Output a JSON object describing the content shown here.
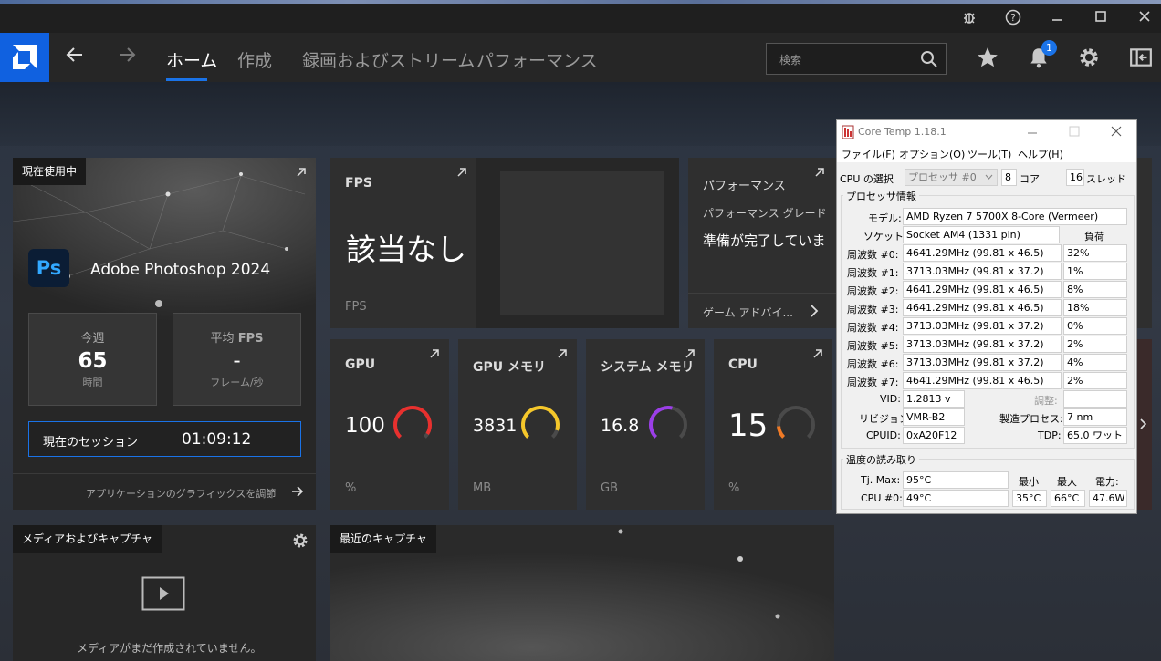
{
  "titlebar": {
    "icons": [
      "bug-icon",
      "help-icon",
      "minimize-icon",
      "maximize-icon",
      "close-icon"
    ]
  },
  "nav": {
    "tabs": [
      "ホーム",
      "作成",
      "録画およびストリーム",
      "パフォーマンス"
    ],
    "active_tab": "ホーム",
    "search_placeholder": "検索",
    "notification_count": "1"
  },
  "current_app": {
    "tag": "現在使用中",
    "app_icon_text": "Ps",
    "app_name": "Adobe Photoshop 2024",
    "week_label": "今週",
    "week_value": "65",
    "week_unit": "時間",
    "fps_label": "平均",
    "fps_label_bold": "FPS",
    "fps_value": "-",
    "fps_unit": "フレーム/秒",
    "session_label": "現在のセッション",
    "session_value": "01:09:12",
    "adjust_link": "アプリケーションのグラフィックスを調節"
  },
  "fps_card": {
    "title": "FPS",
    "value": "該当なし",
    "unit": "FPS"
  },
  "perf_card": {
    "title": "パフォーマンス",
    "grade_label": "パフォーマンス グレード",
    "grade_value": "準備が完了していま",
    "advisor": "ゲーム アドバイ..."
  },
  "metrics": [
    {
      "title": "GPU",
      "value": "100",
      "unit": "%",
      "fraction": 0.95,
      "color": "#e8302e"
    },
    {
      "title": "GPU メモリ",
      "value": "3831",
      "unit": "MB",
      "fraction": 0.9,
      "color": "#f5c72a"
    },
    {
      "title": "システム メモリ",
      "value": "16.8",
      "unit": "GB",
      "fraction": 0.55,
      "color": "#9b3ee8"
    },
    {
      "title": "CPU",
      "value": "15",
      "unit": "%",
      "fraction": 0.15,
      "color": "#f07a25"
    }
  ],
  "media": {
    "tag": "メディアおよびキャプチャ",
    "empty_text": "メディアがまだ作成されていません。"
  },
  "recent": {
    "tag": "最近のキャプチャ"
  },
  "coretemp": {
    "title": "Core Temp 1.18.1",
    "menu": [
      "ファイル(F)",
      "オプション(O)",
      "ツール(T)",
      "ヘルプ(H)"
    ],
    "cpu_select_label": "CPU の選択",
    "cpu_select_value": "プロセッサ #0",
    "cores_value": "8",
    "cores_label": "コア",
    "threads_value": "16",
    "threads_label": "スレッド",
    "proc_group": "プロセッサ情報",
    "model_label": "モデル:",
    "model_value": "AMD Ryzen 7 5700X 8-Core (Vermeer)",
    "socket_label": "ソケット:",
    "socket_value": "Socket AM4 (1331 pin)",
    "load_header": "負荷",
    "freqs": [
      {
        "label": "周波数 #0:",
        "value": "4641.29MHz (99.81 x 46.5)",
        "load": "32%"
      },
      {
        "label": "周波数 #1:",
        "value": "3713.03MHz (99.81 x 37.2)",
        "load": "1%"
      },
      {
        "label": "周波数 #2:",
        "value": "4641.29MHz (99.81 x 46.5)",
        "load": "8%"
      },
      {
        "label": "周波数 #3:",
        "value": "4641.29MHz (99.81 x 46.5)",
        "load": "18%"
      },
      {
        "label": "周波数 #4:",
        "value": "3713.03MHz (99.81 x 37.2)",
        "load": "0%"
      },
      {
        "label": "周波数 #5:",
        "value": "3713.03MHz (99.81 x 37.2)",
        "load": "2%"
      },
      {
        "label": "周波数 #6:",
        "value": "3713.03MHz (99.81 x 37.2)",
        "load": "4%"
      },
      {
        "label": "周波数 #7:",
        "value": "4641.29MHz (99.81 x 46.5)",
        "load": "2%"
      }
    ],
    "vid_label": "VID:",
    "vid_value": "1.2813 v",
    "adjust_label": "調整:",
    "revision_label": "リビジョン",
    "revision_value": "VMR-B2",
    "process_label": "製造プロセス:",
    "process_value": "7 nm",
    "cpuid_label": "CPUID:",
    "cpuid_value": "0xA20F12",
    "tdp_label": "TDP:",
    "tdp_value": "65.0 ワット",
    "temp_group": "温度の読み取り",
    "tjmax_label": "Tj. Max:",
    "tjmax_value": "95°C",
    "min_label": "最小",
    "max_label": "最大",
    "power_label": "電力:",
    "cpu0_label": "CPU #0:",
    "cpu0_value": "49°C",
    "cpu0_min": "35°C",
    "cpu0_max": "66°C",
    "cpu0_power": "47.6W"
  }
}
